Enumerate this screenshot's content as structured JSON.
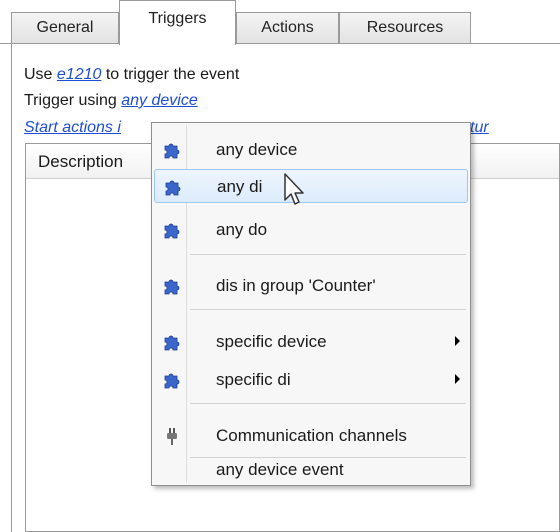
{
  "tabs": [
    {
      "label": "General"
    },
    {
      "label": "Triggers",
      "active": true
    },
    {
      "label": "Actions"
    },
    {
      "label": "Resources"
    }
  ],
  "trigger_panel": {
    "use_prefix": "Use",
    "use_link": "e1210",
    "use_suffix": "to trigger the event",
    "trigger_prefix": "Trigger using",
    "trigger_link": "any device",
    "start_actions_left": "Start actions i",
    "start_actions_right": "tur"
  },
  "grid": {
    "columns": [
      "Description"
    ]
  },
  "context_menu": {
    "items": [
      {
        "label": "any device",
        "icon": "puzzle-icon"
      },
      {
        "label": "any di",
        "icon": "puzzle-icon",
        "hovered": true
      },
      {
        "label": "any do",
        "icon": "puzzle-icon"
      },
      {
        "label": "dis in group 'Counter'",
        "icon": "puzzle-icon"
      },
      {
        "label": "specific device",
        "icon": "puzzle-icon",
        "submenu": true
      },
      {
        "label": "specific di",
        "icon": "puzzle-icon",
        "submenu": true
      },
      {
        "label": "Communication channels",
        "icon": "plug-icon"
      },
      {
        "label": "any device event"
      }
    ]
  },
  "colors": {
    "link": "#1f4fd1",
    "menu_hover": "#dcebfb",
    "puzzle_icon": "#3a67c9"
  }
}
